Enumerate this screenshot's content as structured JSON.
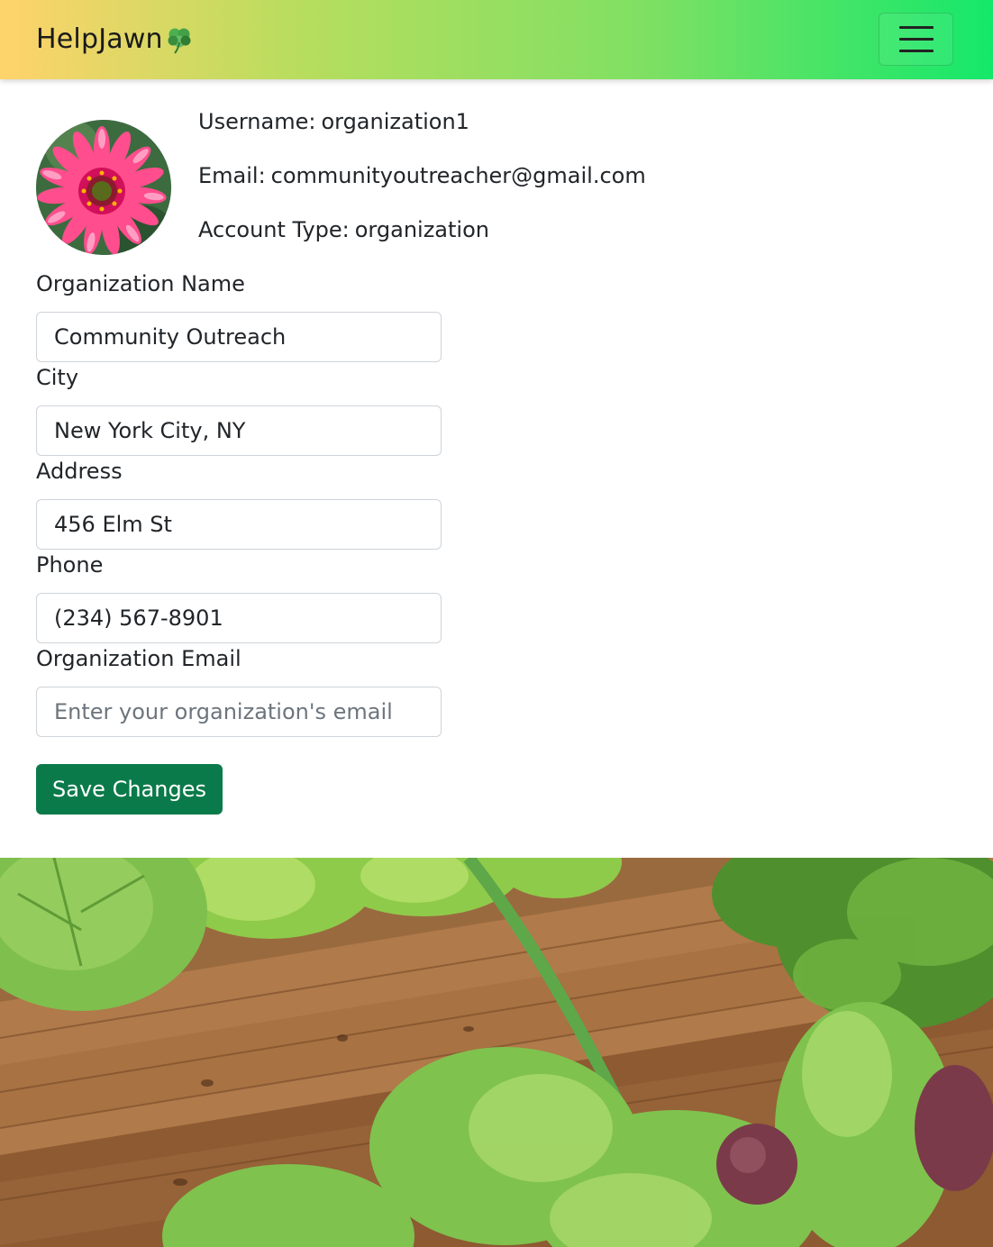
{
  "navbar": {
    "brand": "HelpJawn",
    "brand_icon": "shamrock-icon",
    "menu_icon": "hamburger-menu-icon",
    "gradient": [
      "#ffd36b",
      "#14e86a"
    ]
  },
  "profile": {
    "avatar_icon": "flower-avatar",
    "username_label": "Username:",
    "username": "organization1",
    "email_label": "Email:",
    "email": "communityoutreacher@gmail.com",
    "account_type_label": "Account Type:",
    "account_type": "organization"
  },
  "form": {
    "org_name_label": "Organization Name",
    "org_name_value": "Community Outreach",
    "city_label": "City",
    "city_value": "New York City, NY",
    "address_label": "Address",
    "address_value": "456 Elm St",
    "phone_label": "Phone",
    "phone_value": "(234) 567-8901",
    "org_email_label": "Organization Email",
    "org_email_value": "",
    "org_email_placeholder": "Enter your organization's email",
    "save_label": "Save Changes",
    "save_color": "#0b7a4a"
  },
  "footer_image": {
    "description_icon": "garden-bed-image"
  }
}
